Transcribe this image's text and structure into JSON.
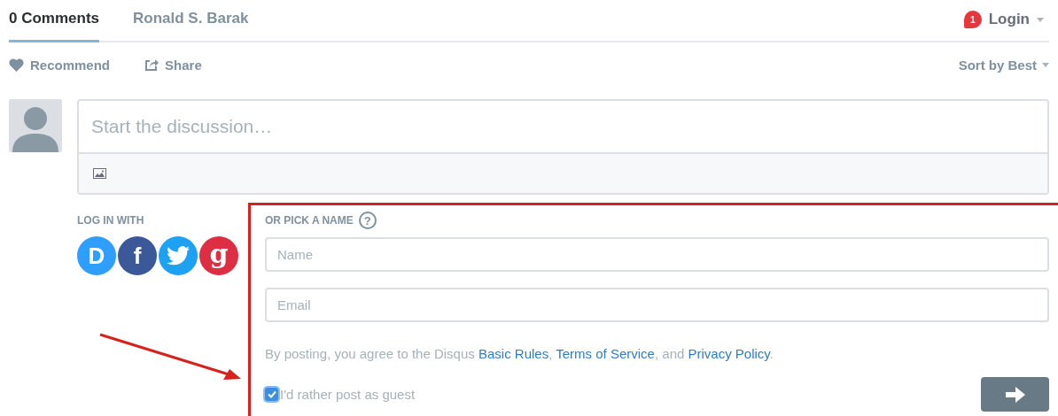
{
  "tabs": [
    {
      "label": "0 Comments",
      "selected": true
    },
    {
      "label": "Ronald S. Barak",
      "selected": false
    }
  ],
  "login": {
    "badge": "1",
    "label": "Login"
  },
  "actions": [
    {
      "kind": "recommend",
      "label": "Recommend"
    },
    {
      "kind": "share",
      "label": "Share"
    }
  ],
  "sort": {
    "label": "Sort by Best"
  },
  "composer": {
    "placeholder": "Start the discussion…"
  },
  "log_in_with": {
    "label": "LOG IN WITH",
    "providers": [
      {
        "kind": "disqus",
        "glyph": "D"
      },
      {
        "kind": "facebook",
        "glyph": "f"
      },
      {
        "kind": "twitter"
      },
      {
        "kind": "google",
        "glyph": "g"
      }
    ]
  },
  "guest_form": {
    "heading": "OR PICK A NAME",
    "help": "?",
    "name_placeholder": "Name",
    "email_placeholder": "Email",
    "terms": [
      {
        "kind": "text",
        "text": "By posting, you agree to the Disqus "
      },
      {
        "kind": "link",
        "text": "Basic Rules"
      },
      {
        "kind": "text",
        "text": ", "
      },
      {
        "kind": "link",
        "text": "Terms of Service"
      },
      {
        "kind": "text",
        "text": ", and "
      },
      {
        "kind": "link",
        "text": "Privacy Policy"
      },
      {
        "kind": "text",
        "text": "."
      }
    ],
    "guest": {
      "label": "I'd rather post as guest",
      "checked": true
    }
  }
}
